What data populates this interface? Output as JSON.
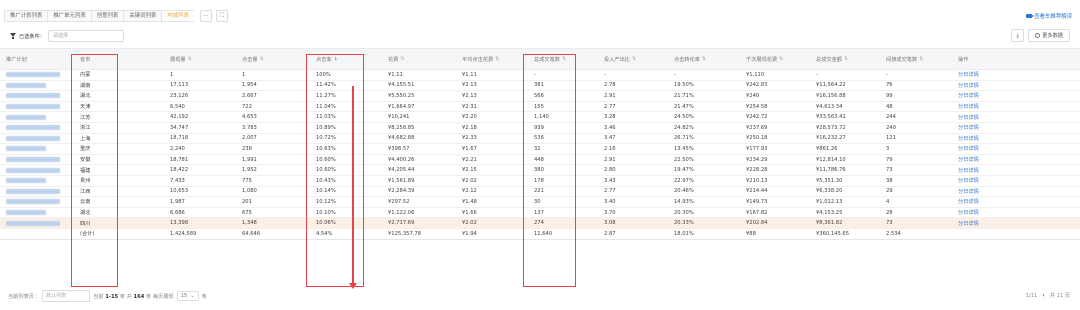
{
  "tabs": [
    {
      "label": "推广计划列表",
      "active": false
    },
    {
      "label": "推广单元列表",
      "active": false
    },
    {
      "label": "创意列表",
      "active": false
    },
    {
      "label": "关键词列表",
      "active": false
    },
    {
      "label": "地域列表",
      "active": true
    }
  ],
  "tab_tools": {
    "more": "···",
    "expand": "⛶"
  },
  "help_link": "查看车推荐解读",
  "filter": {
    "label": "已选条件：",
    "placeholder": "请选择"
  },
  "toolbar": {
    "download_icon": "⤓",
    "more_data": "更多数据"
  },
  "columns": [
    "推广计划",
    "省市",
    "展现量",
    "点击量",
    "点击率",
    "花费",
    "平均点击花费",
    "总成交笔数",
    "投入产出比",
    "点击转化率",
    "千次展现花费",
    "总成交金额",
    "间接成交笔数",
    "操作"
  ],
  "sorted_column": "点击率",
  "sort_icons": {
    "none": "⇅",
    "desc": "↓"
  },
  "rows": [
    {
      "region": "内蒙",
      "impressions": "1",
      "clicks": "1",
      "ctr": "100%",
      "cost": "¥1.11",
      "cpc": "¥1.11",
      "orders": "-",
      "roi": "-",
      "cvr": "-",
      "cpm": "¥1,110",
      "gmv": "-",
      "indirect": "-",
      "action": "分日详情"
    },
    {
      "region": "湖南",
      "impressions": "17,113",
      "clicks": "1,954",
      "ctr": "11.42%",
      "cost": "¥4,155.51",
      "cpc": "¥2.13",
      "orders": "381",
      "roi": "2.78",
      "cvr": "19.50%",
      "cpm": "¥242.83",
      "gmv": "¥11,564.22",
      "indirect": "76",
      "action": "分日详情"
    },
    {
      "region": "湖北",
      "impressions": "23,126",
      "clicks": "2,667",
      "ctr": "11.27%",
      "cost": "¥5,550.25",
      "cpc": "¥2.13",
      "orders": "566",
      "roi": "2.91",
      "cvr": "21.71%",
      "cpm": "¥240",
      "gmv": "¥16,156.88",
      "indirect": "99",
      "action": "分日详情"
    },
    {
      "region": "天津",
      "impressions": "6,540",
      "clicks": "722",
      "ctr": "11.04%",
      "cost": "¥1,664.97",
      "cpc": "¥2.31",
      "orders": "155",
      "roi": "2.77",
      "cvr": "21.47%",
      "cpm": "¥254.58",
      "gmv": "¥4,613.34",
      "indirect": "48",
      "action": "分日详情"
    },
    {
      "region": "江苏",
      "impressions": "42,192",
      "clicks": "4,653",
      "ctr": "11.03%",
      "cost": "¥10,241",
      "cpc": "¥2.20",
      "orders": "1,140",
      "roi": "3.28",
      "cvr": "24.50%",
      "cpm": "¥242.72",
      "gmv": "¥33,563.41",
      "indirect": "244",
      "action": "分日详情"
    },
    {
      "region": "浙江",
      "impressions": "34,747",
      "clicks": "3,783",
      "ctr": "10.89%",
      "cost": "¥8,258.85",
      "cpc": "¥2.18",
      "orders": "939",
      "roi": "3.46",
      "cvr": "24.82%",
      "cpm": "¥237.69",
      "gmv": "¥28,573.72",
      "indirect": "240",
      "action": "分日详情"
    },
    {
      "region": "上海",
      "impressions": "18,718",
      "clicks": "2,007",
      "ctr": "10.72%",
      "cost": "¥4,682.88",
      "cpc": "¥2.33",
      "orders": "536",
      "roi": "3.47",
      "cvr": "26.71%",
      "cpm": "¥250.18",
      "gmv": "¥16,232.27",
      "indirect": "121",
      "action": "分日详情"
    },
    {
      "region": "重庆",
      "impressions": "2,240",
      "clicks": "238",
      "ctr": "10.63%",
      "cost": "¥398.57",
      "cpc": "¥1.67",
      "orders": "32",
      "roi": "2.16",
      "cvr": "13.45%",
      "cpm": "¥177.93",
      "gmv": "¥861.26",
      "indirect": "3",
      "action": "分日详情"
    },
    {
      "region": "安徽",
      "impressions": "18,781",
      "clicks": "1,991",
      "ctr": "10.60%",
      "cost": "¥4,400.26",
      "cpc": "¥2.21",
      "orders": "448",
      "roi": "2.91",
      "cvr": "22.50%",
      "cpm": "¥234.29",
      "gmv": "¥12,814.10",
      "indirect": "79",
      "action": "分日详情"
    },
    {
      "region": "福建",
      "impressions": "18,422",
      "clicks": "1,952",
      "ctr": "10.60%",
      "cost": "¥4,205.44",
      "cpc": "¥2.15",
      "orders": "380",
      "roi": "2.80",
      "cvr": "19.47%",
      "cpm": "¥228.28",
      "gmv": "¥11,786.76",
      "indirect": "73",
      "action": "分日详情"
    },
    {
      "region": "贵州",
      "impressions": "7,433",
      "clicks": "775",
      "ctr": "10.43%",
      "cost": "¥1,561.89",
      "cpc": "¥2.02",
      "orders": "178",
      "roi": "3.43",
      "cvr": "22.97%",
      "cpm": "¥210.13",
      "gmv": "¥5,351.30",
      "indirect": "38",
      "action": "分日详情"
    },
    {
      "region": "江西",
      "impressions": "10,653",
      "clicks": "1,080",
      "clicks_note": "",
      "ctr": "10.14%",
      "cost": "¥2,284.39",
      "cpc": "¥2.12",
      "orders": "221",
      "roi": "2.77",
      "cvr": "20.46%",
      "cpm": "¥214.44",
      "gmv": "¥6,338.20",
      "indirect": "29",
      "action": "分日详情"
    },
    {
      "region": "云南",
      "impressions": "1,987",
      "clicks": "201",
      "ctr": "10.12%",
      "cost": "¥297.52",
      "cpc": "¥1.48",
      "orders": "30",
      "roi": "3.40",
      "cvr": "14.93%",
      "cpm": "¥149.73",
      "gmv": "¥1,012.13",
      "indirect": "4",
      "action": "分日详情"
    },
    {
      "region": "湖北",
      "impressions": "6,686",
      "clicks": "675",
      "ctr": "10.10%",
      "cost": "¥1,122.06",
      "cpc": "¥1.66",
      "orders": "137",
      "roi": "3.70",
      "cvr": "20.30%",
      "cpm": "¥167.82",
      "gmv": "¥4,153.25",
      "indirect": "28",
      "action": "分日详情"
    },
    {
      "region": "四川",
      "impressions": "13,398",
      "clicks": "1,348",
      "ctr": "10.06%",
      "cost": "¥2,717.69",
      "cpc": "¥2.02",
      "orders": "274",
      "roi": "3.08",
      "cvr": "20.33%",
      "cpm": "¥202.84",
      "gmv": "¥8,361.82",
      "indirect": "73",
      "action": "分日详情"
    }
  ],
  "total": {
    "region": "(合计)",
    "impressions": "1,424,589",
    "clicks": "64,646",
    "ctr": "4.54%",
    "cost": "¥125,357.78",
    "cpc": "¥1.94",
    "orders": "11,640",
    "roi": "2.87",
    "cvr": "18.01%",
    "cpm": "¥88",
    "gmv": "¥360,145.65",
    "indirect": "2,534"
  },
  "pagination": {
    "label": "当前列表页：",
    "placeholder": "默认列表",
    "current_prefix": "当前",
    "current_range": "1-15",
    "unit1": "条  共",
    "total": "164",
    "unit2": "条  每页展现",
    "page_size": "15",
    "unit3": "条",
    "page_info": "1/11",
    "next": "›",
    "total_pages": "共 11 页"
  }
}
